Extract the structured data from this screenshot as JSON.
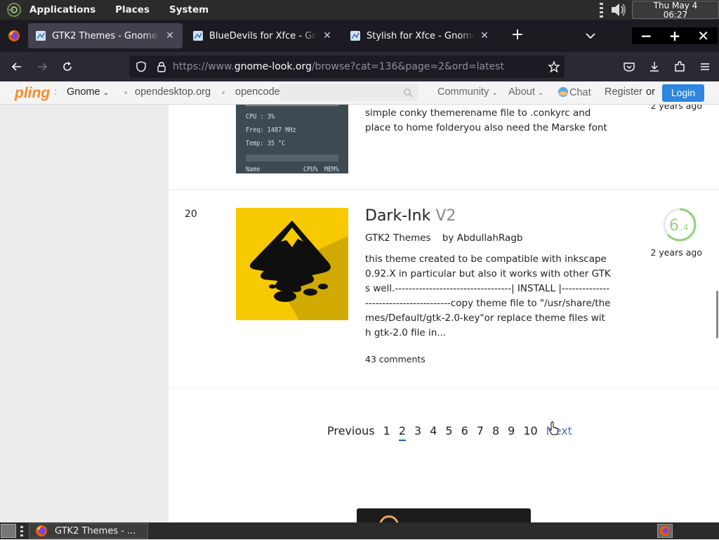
{
  "top_panel": {
    "menus": [
      "Applications",
      "Places",
      "System"
    ],
    "clock": {
      "date": "Thu May  4",
      "time": "06:27"
    }
  },
  "tabs": [
    {
      "title": "GTK2 Themes - Gnome-look",
      "active": true
    },
    {
      "title": "BlueDevils for Xfce - Gnome-look",
      "active": false
    },
    {
      "title": "Stylish for Xfce - Gnome-look",
      "active": false
    }
  ],
  "window_controls": {
    "minimize": "−",
    "maximize": "+",
    "close": "✕"
  },
  "url": {
    "prefix": "https://www.",
    "host": "gnome-look.org",
    "path": "/browse?cat=136&page=2&ord=latest"
  },
  "site_header": {
    "logo": "pling",
    "brand_sep": ":",
    "brand": "Gnome",
    "links": {
      "opendesktop": "opendesktop.org",
      "opencode": "opencode",
      "community": "Community",
      "about": "About",
      "chat": "Chat",
      "register": "Register",
      "or": "or"
    },
    "search_placeholder": "",
    "login": "Login"
  },
  "items": [
    {
      "description": "simple conky themerename file to .conkyrc and place to home folderyou also need the Marske font",
      "time": "2 years ago",
      "thumb_lines": [
        "CPU : 3%",
        "Freq: 1487 MHz",
        "Temp: 35 °C",
        "Name",
        "CPU%",
        "MEM%"
      ]
    },
    {
      "rank": "20",
      "title": "Dark-Ink",
      "version": "V2",
      "category": "GTK2 Themes",
      "author": "by AbdullahRagb",
      "description": "this theme created to be compatible with inkscape 0.92.X in particular but also it works with other GTKs well.----------------------------------| INSTALL |---------------------------------------copy theme file to \"/usr/share/themes/Default/gtk-2.0-key\"or replace theme files with gtk-2.0 file in...",
      "comments": "43 comments",
      "score": {
        "major": "6",
        "minor": ".4",
        "value": 6.4
      },
      "time": "2 years ago"
    }
  ],
  "pagination": {
    "previous": "Previous",
    "pages": [
      "1",
      "2",
      "3",
      "4",
      "5",
      "6",
      "7",
      "8",
      "9",
      "10"
    ],
    "current": "2",
    "next": "Next"
  },
  "taskbar": {
    "window_title": "GTK2 Themes - ..."
  },
  "colors": {
    "accent_login": "#2e86de",
    "score_ring": "#8fd17a",
    "pagination_next": "#5a6bc1"
  }
}
